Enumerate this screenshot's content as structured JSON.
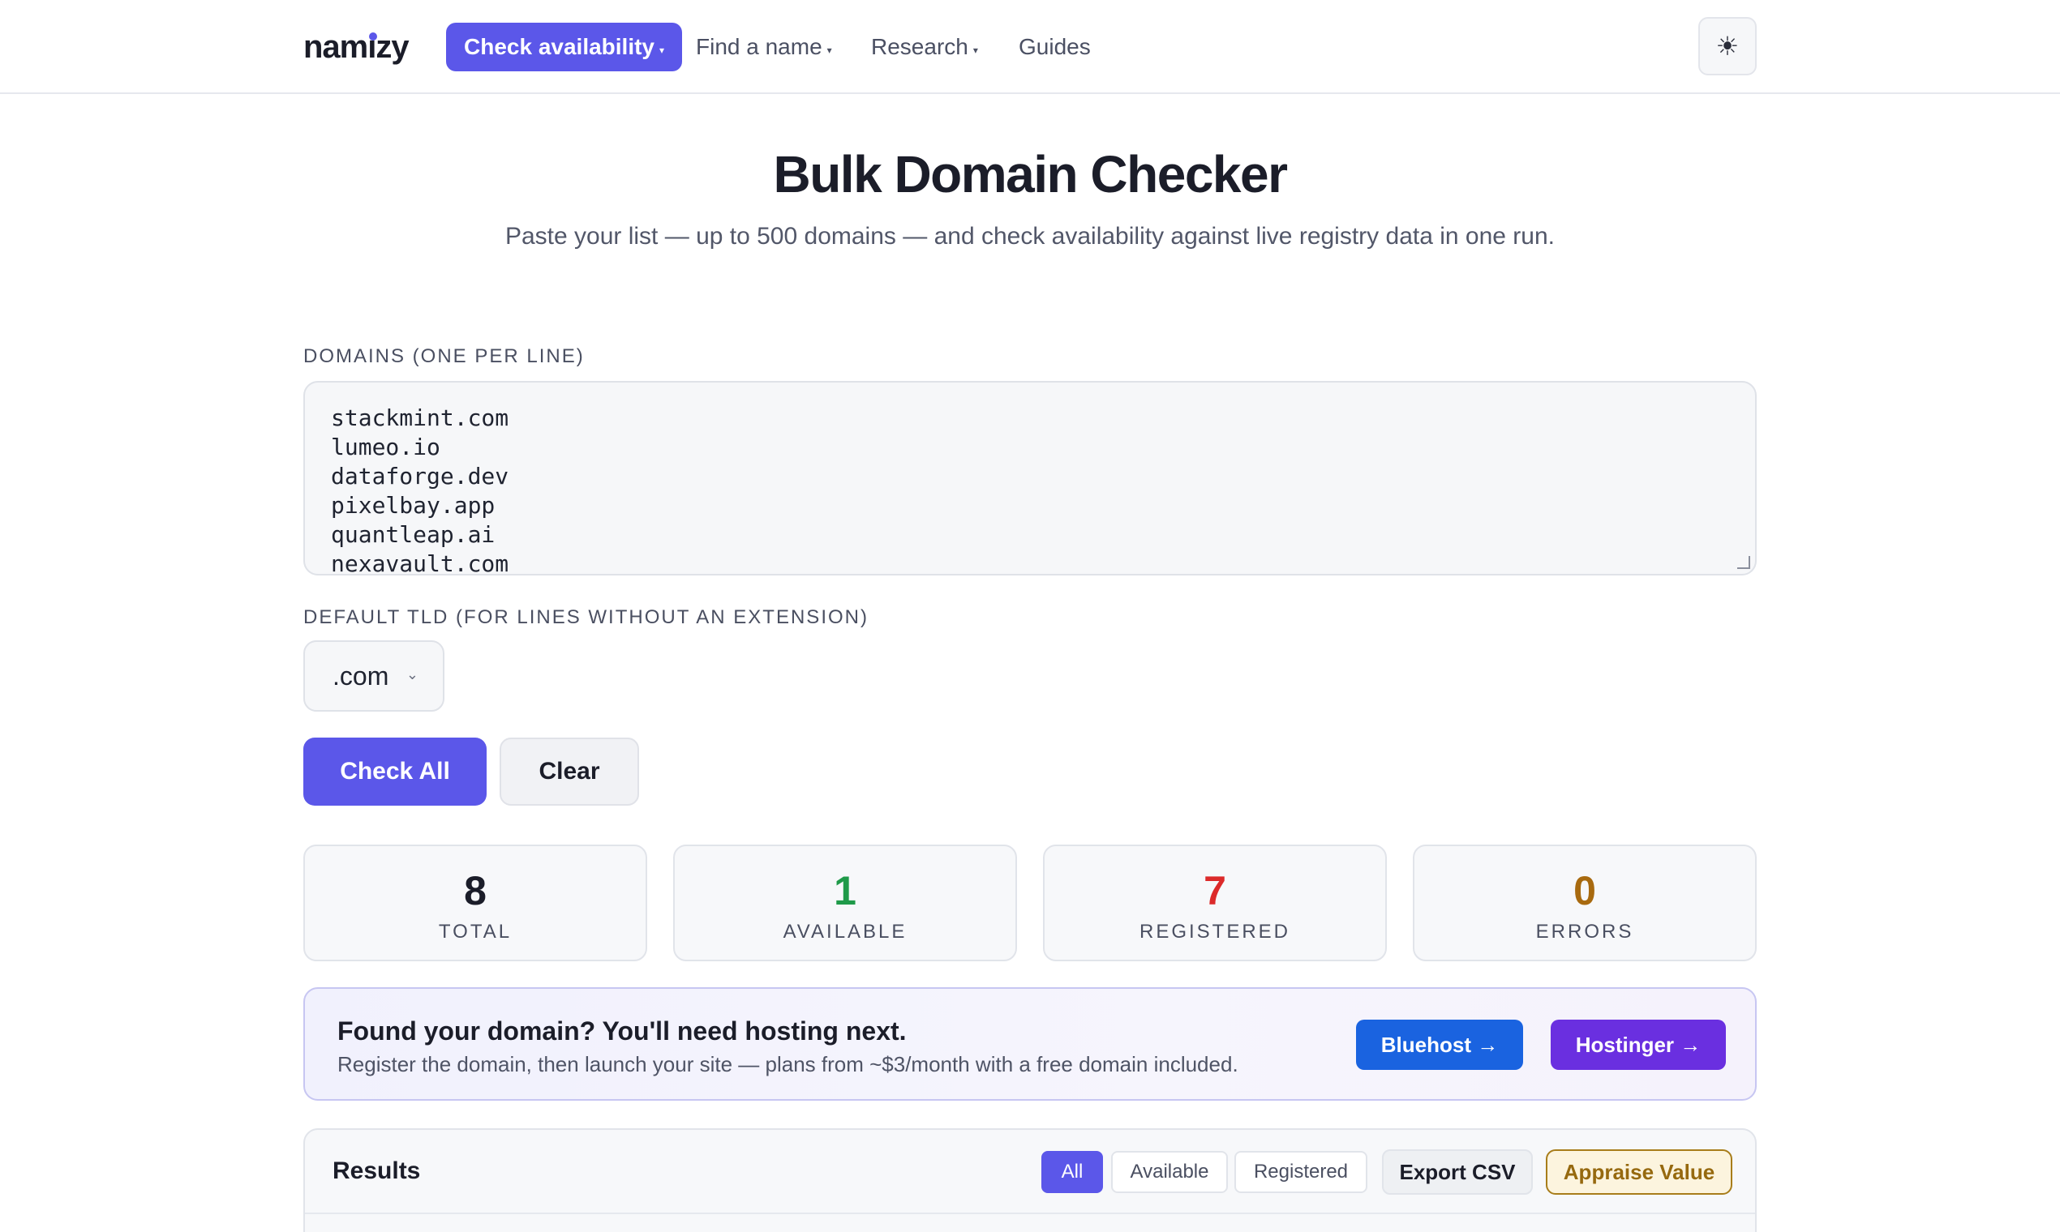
{
  "nav": {
    "logo": "namizy",
    "items": [
      {
        "label": "Check availability",
        "has_caret": true,
        "active": true
      },
      {
        "label": "Find a name",
        "has_caret": true,
        "active": false
      },
      {
        "label": "Research",
        "has_caret": true,
        "active": false
      },
      {
        "label": "Guides",
        "has_caret": false,
        "active": false
      }
    ],
    "theme_icon": "sun-icon",
    "theme_glyph": "☀",
    "caret_glyph": "▾"
  },
  "hero": {
    "title": "Bulk Domain Checker",
    "subtitle": "Paste your list — up to 500 domains — and check availability against live registry data in one run."
  },
  "form": {
    "domains_label": "DOMAINS (ONE PER LINE)",
    "domains_lines": [
      "stackmint.com",
      "lumeo.io",
      "dataforge.dev",
      "pixelbay.app",
      "quantleap.ai",
      "nexavault.com"
    ],
    "tld_label": "DEFAULT TLD (FOR LINES WITHOUT AN EXTENSION)",
    "tld_value": ".com",
    "check_all": "Check All",
    "clear": "Clear"
  },
  "stats": [
    {
      "value": "8",
      "label": "TOTAL",
      "color": "#1b1d29"
    },
    {
      "value": "1",
      "label": "AVAILABLE",
      "color": "#1f9a49"
    },
    {
      "value": "7",
      "label": "REGISTERED",
      "color": "#dc2a2a"
    },
    {
      "value": "0",
      "label": "ERRORS",
      "color": "#a86a0f"
    }
  ],
  "promo": {
    "heading": "Found your domain? You'll need hosting next.",
    "subtext": "Register the domain, then launch your site — plans from ~$3/month with a free domain included.",
    "bluehost": "Bluehost →",
    "hostinger": "Hostinger →",
    "bluehost_color": "#1a63e0",
    "hostinger_color": "#6a2fe0"
  },
  "results": {
    "title": "Results",
    "filters": [
      "All",
      "Available",
      "Registered"
    ],
    "active_filter": "All",
    "export": "Export CSV",
    "appraise": "Appraise Value"
  }
}
